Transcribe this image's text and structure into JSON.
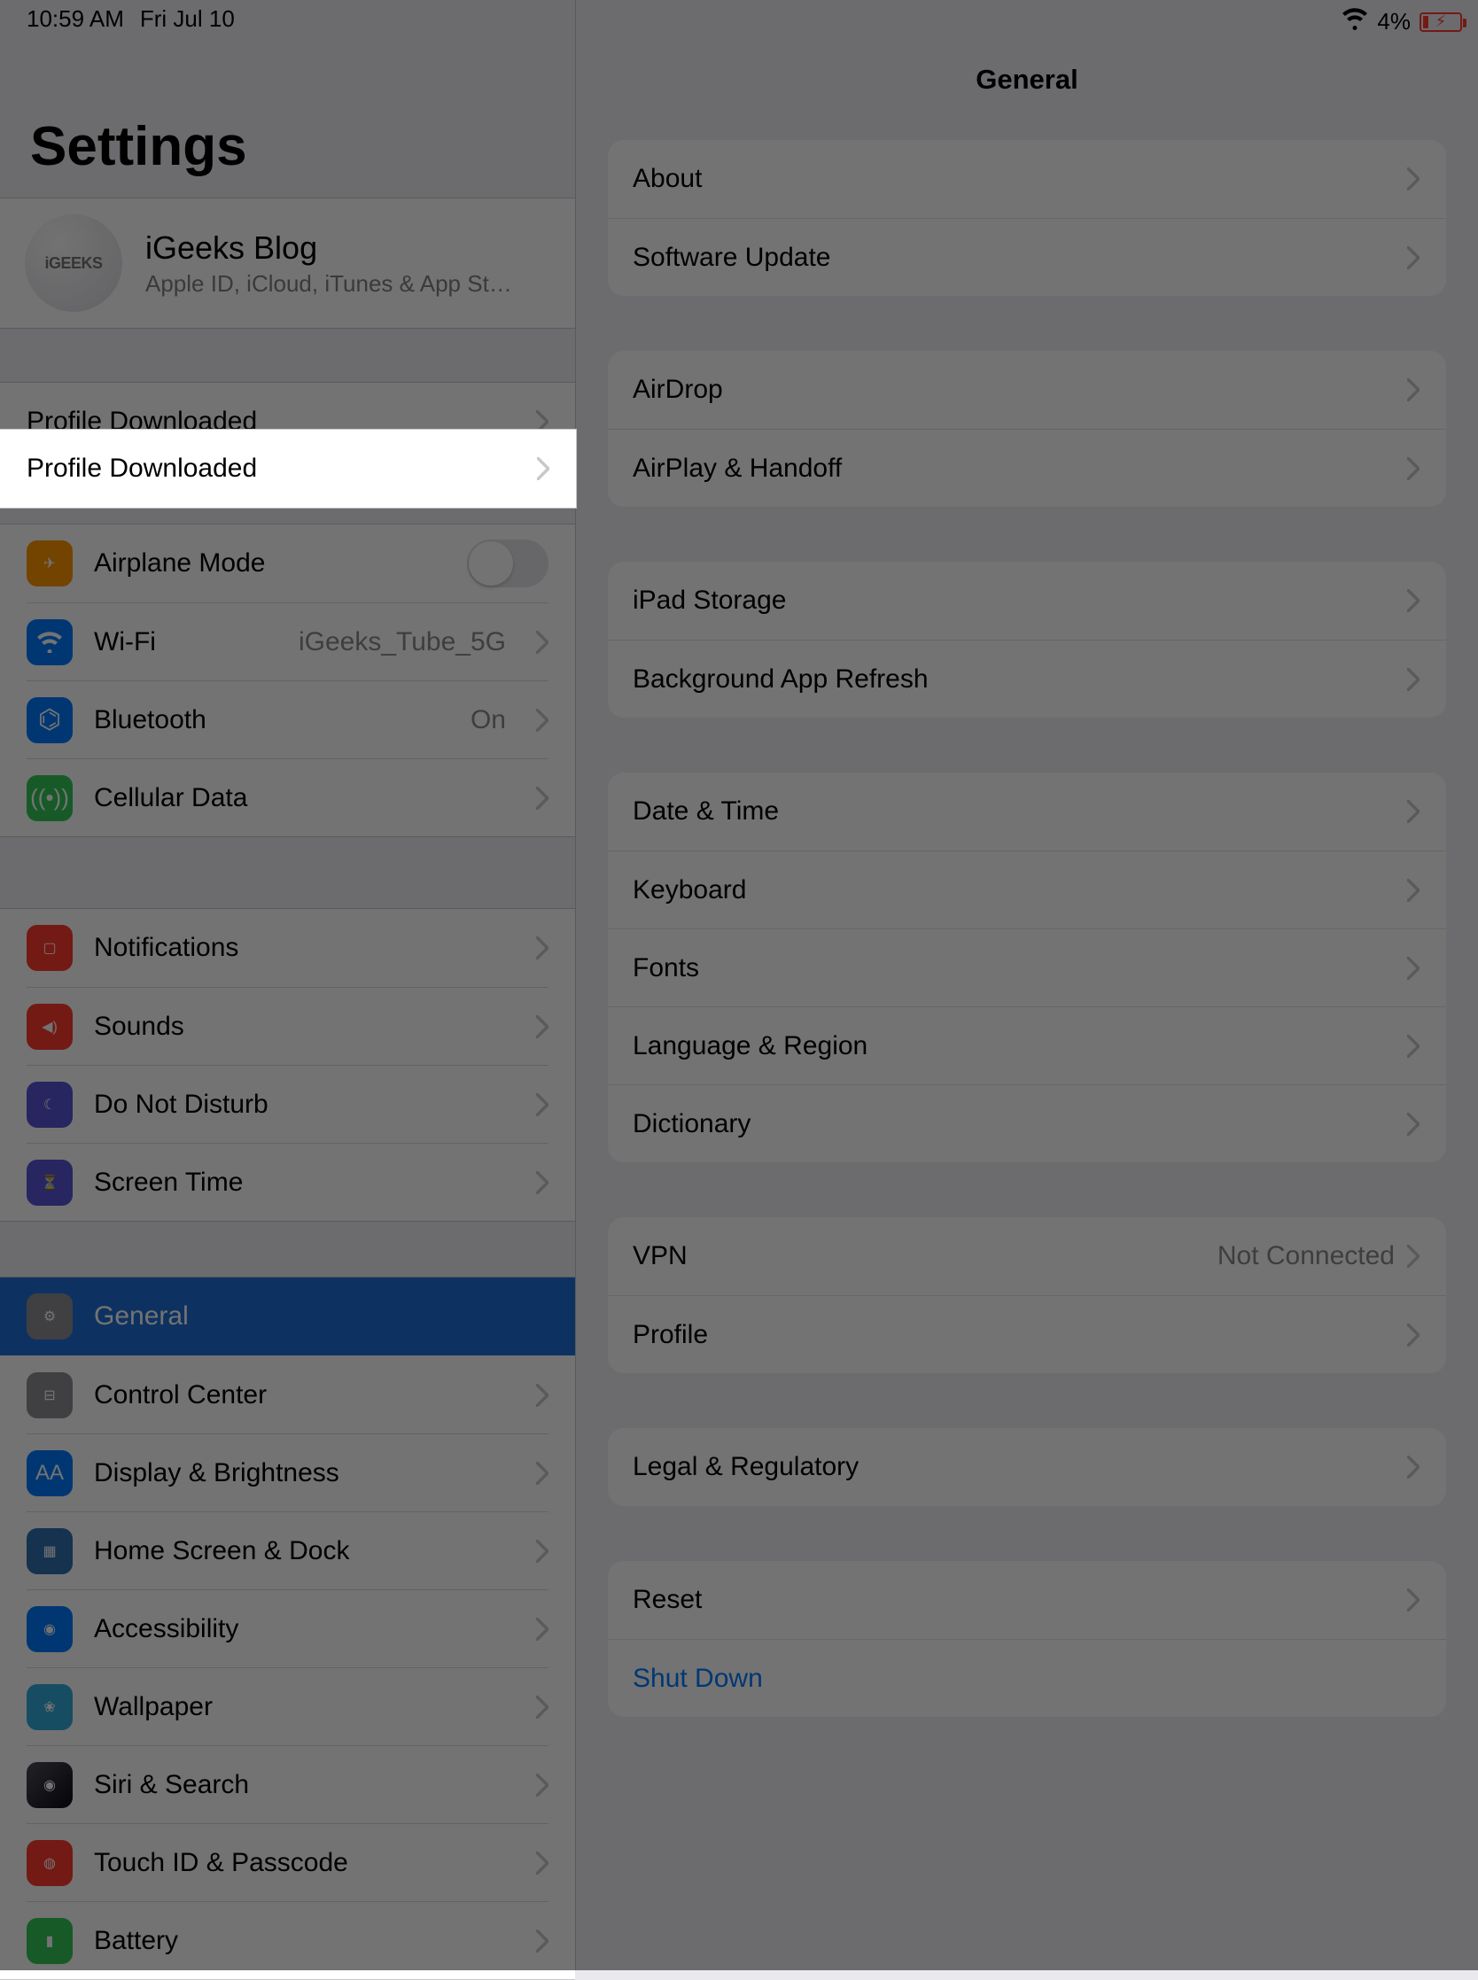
{
  "status": {
    "time": "10:59 AM",
    "date": "Fri Jul 10",
    "battery_pct": "4%"
  },
  "sidebar": {
    "title": "Settings",
    "apple_id": {
      "avatar_text": "iGEEKS",
      "name": "iGeeks Blog",
      "subtitle": "Apple ID, iCloud, iTunes & App St…"
    },
    "profile_row": {
      "label": "Profile Downloaded"
    },
    "radios": {
      "airplane": "Airplane Mode",
      "wifi": "Wi-Fi",
      "wifi_value": "iGeeks_Tube_5G",
      "bluetooth": "Bluetooth",
      "bluetooth_value": "On",
      "cellular": "Cellular Data"
    },
    "notify": {
      "notifications": "Notifications",
      "sounds": "Sounds",
      "dnd": "Do Not Disturb",
      "screen_time": "Screen Time"
    },
    "system": {
      "general": "General",
      "control_center": "Control Center",
      "display": "Display & Brightness",
      "home_dock": "Home Screen & Dock",
      "accessibility": "Accessibility",
      "wallpaper": "Wallpaper",
      "siri": "Siri & Search",
      "touchid": "Touch ID & Passcode",
      "battery": "Battery"
    }
  },
  "detail": {
    "title": "General",
    "g1": {
      "about": "About",
      "software_update": "Software Update"
    },
    "g2": {
      "airdrop": "AirDrop",
      "airplay": "AirPlay & Handoff"
    },
    "g3": {
      "storage": "iPad Storage",
      "bg_refresh": "Background App Refresh"
    },
    "g4": {
      "date_time": "Date & Time",
      "keyboard": "Keyboard",
      "fonts": "Fonts",
      "lang_region": "Language & Region",
      "dictionary": "Dictionary"
    },
    "g5": {
      "vpn": "VPN",
      "vpn_value": "Not Connected",
      "profile": "Profile"
    },
    "g6": {
      "legal": "Legal & Regulatory"
    },
    "g7": {
      "reset": "Reset",
      "shutdown": "Shut Down"
    }
  }
}
